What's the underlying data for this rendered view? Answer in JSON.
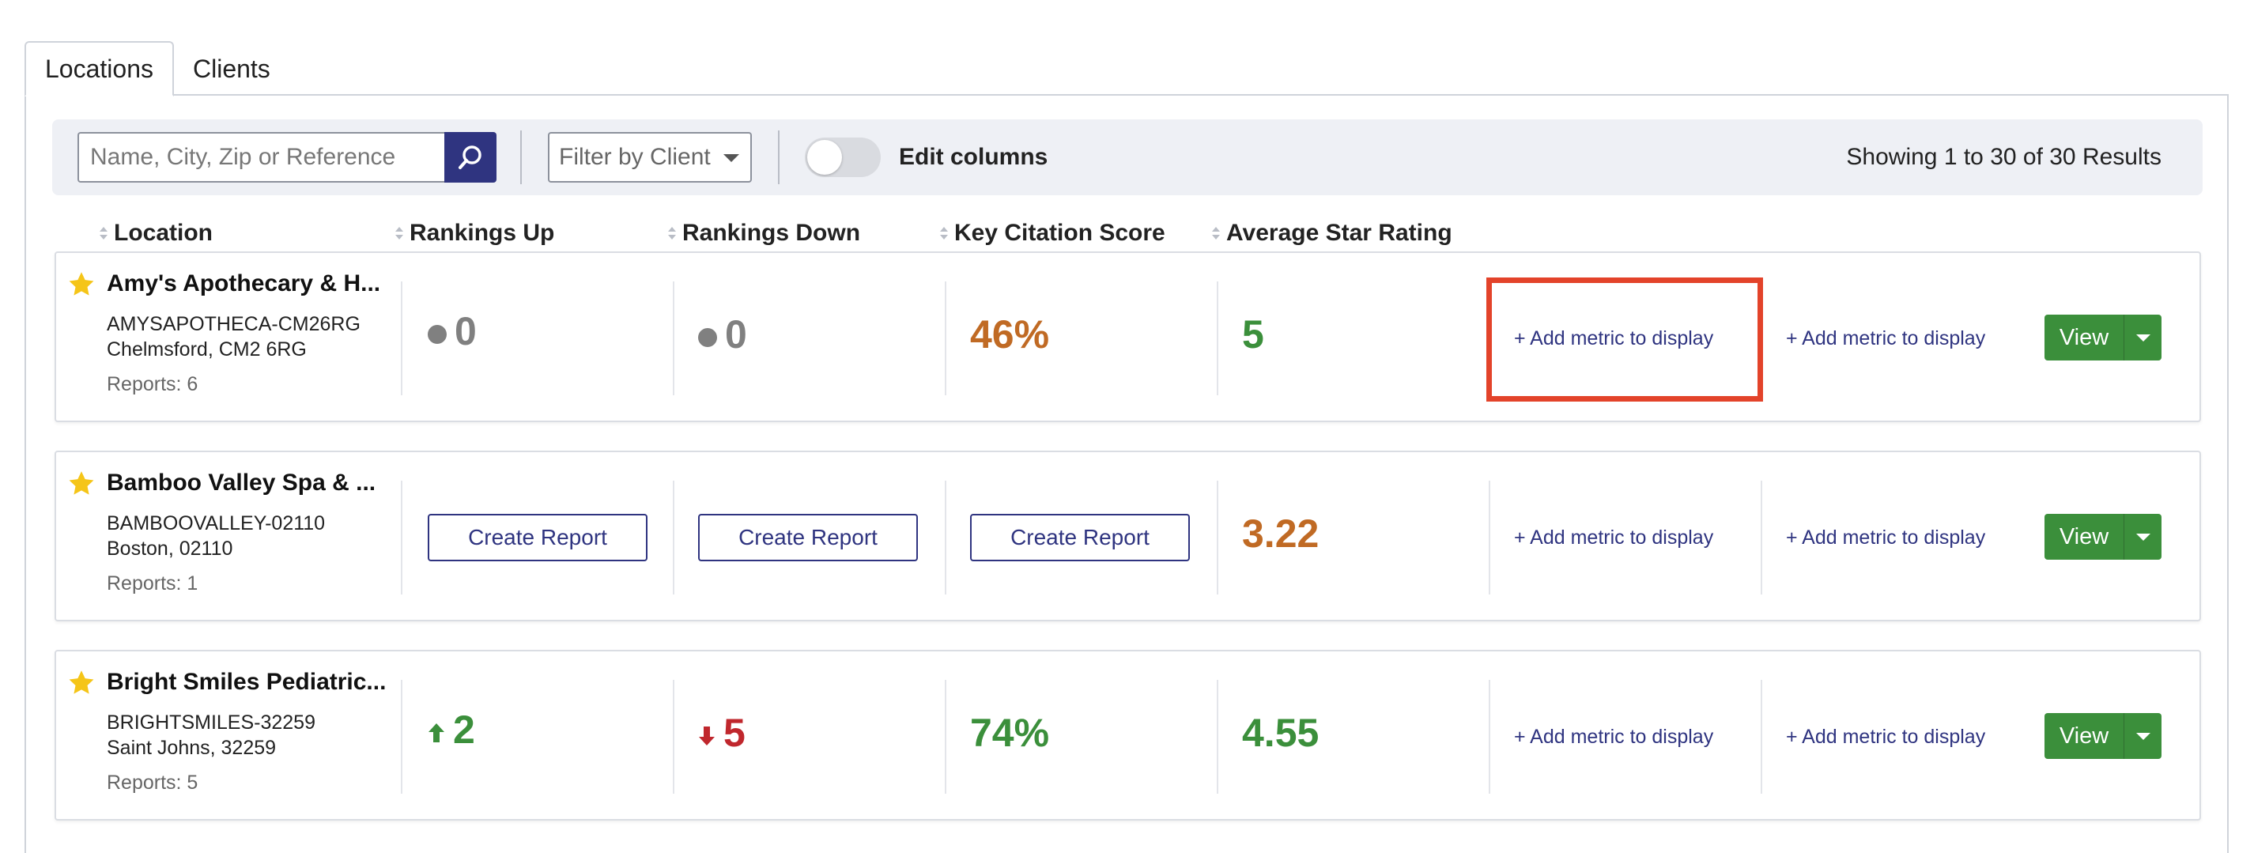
{
  "tabs": [
    {
      "label": "Locations",
      "active": true
    },
    {
      "label": "Clients",
      "active": false
    }
  ],
  "toolbar": {
    "search_placeholder": "Name, City, Zip or Reference",
    "filter_placeholder": "Filter by Client",
    "edit_columns_label": "Edit columns",
    "edit_columns_enabled": false,
    "results_text": "Showing 1 to 30 of 30 Results"
  },
  "columns": [
    "Location",
    "Rankings Up",
    "Rankings Down",
    "Key Citation Score",
    "Average Star Rating"
  ],
  "add_metric_label": "+ Add metric to display",
  "view_label": "View",
  "create_report_label": "Create Report",
  "rows": [
    {
      "name": "Amy's Apothecary & H...",
      "reference": "AMYSAPOTHECA-CM26RG",
      "city": "Chelmsford, CM2 6RG",
      "reports": "Reports: 6",
      "rankings_up": "0",
      "rankings_up_trend": "neutral",
      "rankings_down": "0",
      "rankings_down_trend": "neutral",
      "citation_score": "46%",
      "citation_color": "#c06a24",
      "star_rating": "5",
      "star_color": "#3b8f3b"
    },
    {
      "name": "Bamboo Valley Spa & ...",
      "reference": "BAMBOOVALLEY-02110",
      "city": "Boston, 02110",
      "reports": "Reports: 1",
      "rankings_up": null,
      "rankings_down": null,
      "citation_score": null,
      "star_rating": "3.22",
      "star_color": "#c06a24"
    },
    {
      "name": "Bright Smiles Pediatric...",
      "reference": "BRIGHTSMILES-32259",
      "city": "Saint Johns, 32259",
      "reports": "Reports: 5",
      "rankings_up": "2",
      "rankings_up_trend": "up",
      "rankings_down": "5",
      "rankings_down_trend": "down",
      "citation_score": "74%",
      "citation_color": "#3b8f3b",
      "star_rating": "4.55",
      "star_color": "#3b8f3b"
    }
  ],
  "colors": {
    "primary": "#2f3480",
    "success": "#3b8f3b",
    "warning": "#c06a24",
    "danger": "#c0272d",
    "neutral": "#808080",
    "highlight": "#e3432a",
    "star": "#f5c518"
  },
  "icons": {
    "search": "magnifier-icon",
    "favorite": "star-icon",
    "up": "arrow-up-icon",
    "down": "arrow-down-icon"
  }
}
